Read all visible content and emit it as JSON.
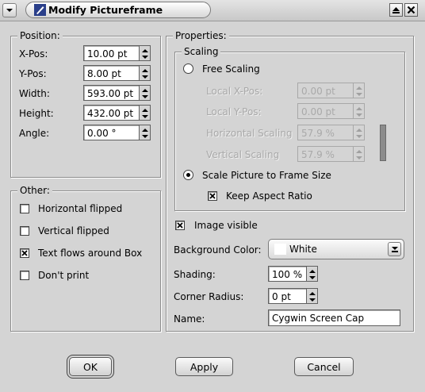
{
  "window": {
    "title": "Modify Pictureframe",
    "buttons": [
      "shade",
      "close"
    ]
  },
  "position": {
    "group_label": "Position:",
    "fields": [
      {
        "label": "X-Pos:",
        "value": "10.00 pt"
      },
      {
        "label": "Y-Pos:",
        "value": "8.00 pt"
      },
      {
        "label": "Width:",
        "value": "593.00 pt"
      },
      {
        "label": "Height:",
        "value": "432.00 pt"
      },
      {
        "label": "Angle:",
        "value": "0.00 °"
      }
    ]
  },
  "other": {
    "group_label": "Other:",
    "checkboxes": [
      {
        "label": "Horizontal flipped",
        "checked": false
      },
      {
        "label": "Vertical flipped",
        "checked": false
      },
      {
        "label": "Text flows around Box",
        "checked": true
      },
      {
        "label": "Don't print",
        "checked": false
      }
    ]
  },
  "properties": {
    "group_label": "Properties:",
    "scaling": {
      "group_label": "Scaling",
      "free_scaling_label": "Free Scaling",
      "free_scaling_selected": false,
      "fields": [
        {
          "label": "Local X-Pos:",
          "value": "0.00 pt"
        },
        {
          "label": "Local Y-Pos:",
          "value": "0.00 pt"
        },
        {
          "label": "Horizontal Scaling",
          "value": "57.9 %"
        },
        {
          "label": "Vertical Scaling",
          "value": "57.9 %"
        }
      ],
      "fields_enabled": false,
      "scale_to_frame_label": "Scale Picture to Frame Size",
      "scale_to_frame_selected": true,
      "keep_aspect_label": "Keep Aspect Ratio",
      "keep_aspect_checked": true
    },
    "image_visible_label": "Image visible",
    "image_visible_checked": true,
    "background_color_label": "Background Color:",
    "background_color_value": "White",
    "shading_label": "Shading:",
    "shading_value": "100 %",
    "corner_radius_label": "Corner Radius:",
    "corner_radius_value": "0 pt",
    "name_label": "Name:",
    "name_value": "Cygwin Screen Cap"
  },
  "buttons": {
    "ok": "OK",
    "apply": "Apply",
    "cancel": "Cancel"
  },
  "colors": {
    "dialog_bg": "#d4d4d4",
    "disabled_text": "#a9a9a9"
  }
}
